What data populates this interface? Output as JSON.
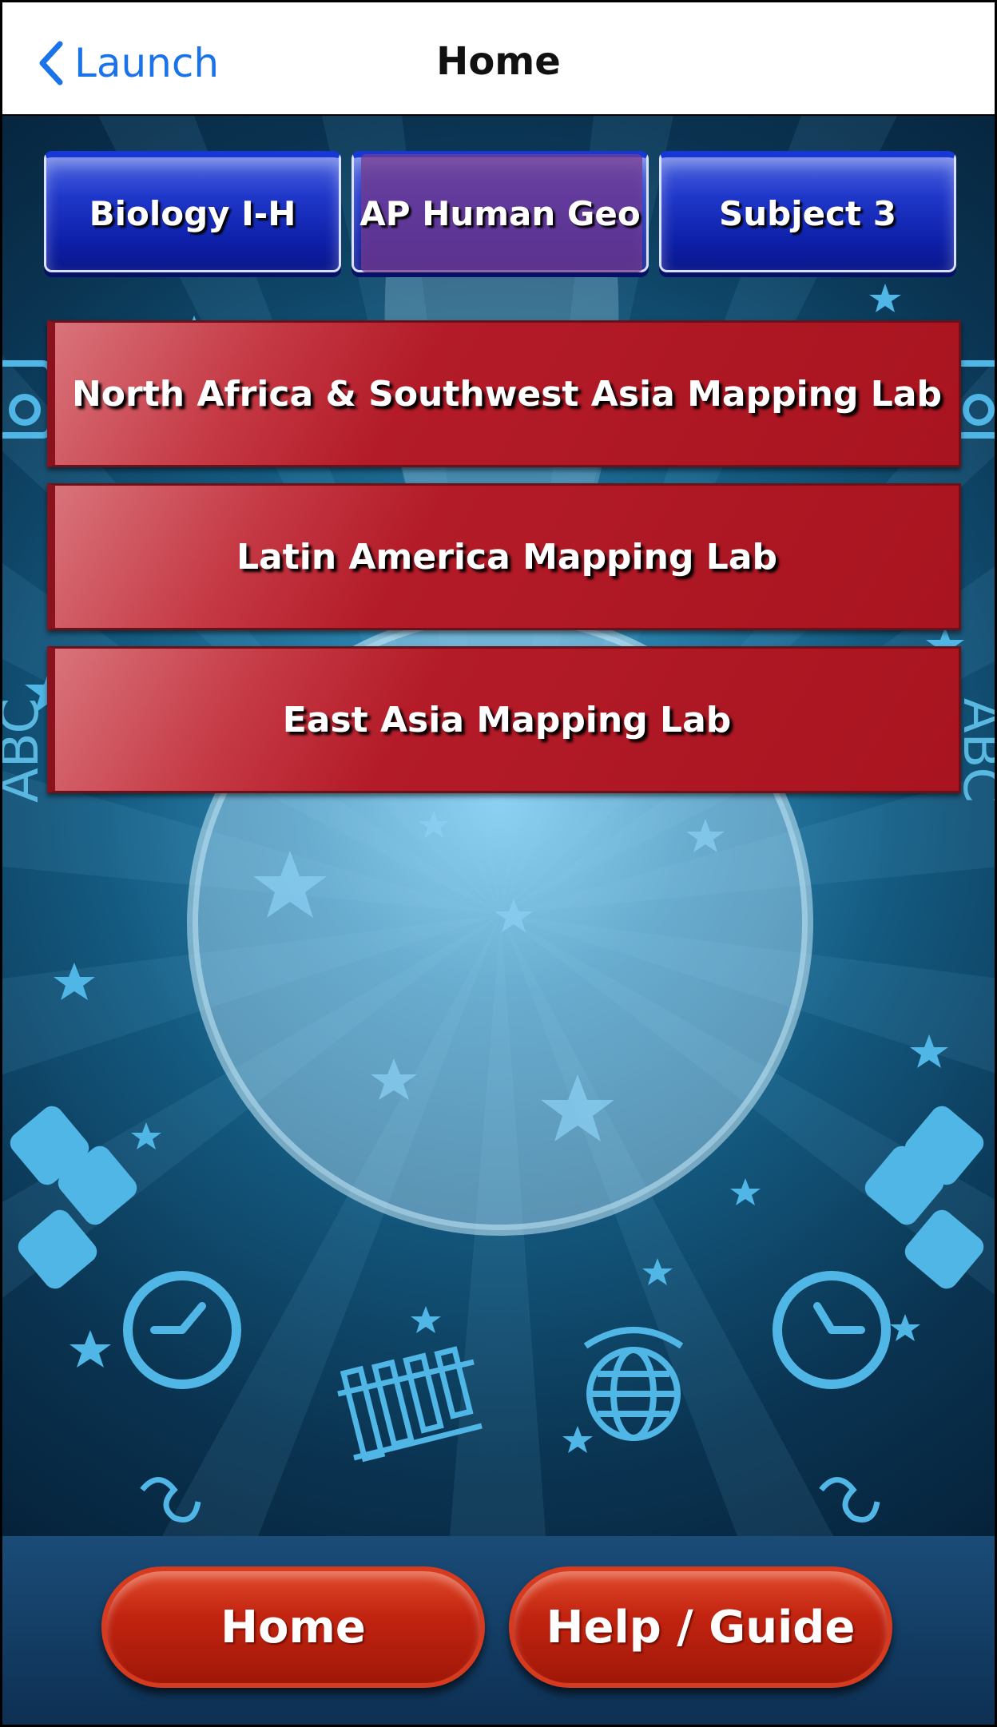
{
  "navbar": {
    "back_label": "Launch",
    "title": "Home"
  },
  "subjects": {
    "tab1": "Biology I-H",
    "tab2": "AP Human Geo",
    "tab3": "Subject 3",
    "selected_index": 1
  },
  "labs": [
    {
      "label": "North Africa & Southwest Asia Mapping Lab"
    },
    {
      "label": "Latin America Mapping Lab"
    },
    {
      "label": "East Asia Mapping Lab"
    }
  ],
  "decor": {
    "side_text_left": "ABC",
    "side_text_right": "ABC",
    "icons": [
      "star-icon",
      "clock-icon",
      "calculator-icon",
      "globe-icon",
      "xylophone-icon",
      "om-icon",
      "camera-icon"
    ]
  },
  "bottom": {
    "home_label": "Home",
    "help_label": "Help / Guide"
  },
  "colors": {
    "nav_accent": "#1a73e8",
    "tab_blue": "#1f37c9",
    "tab_selected": "#7a3c8c",
    "lab_red": "#b31b28",
    "pill_red": "#c22410",
    "background_blue": "#0a3452"
  }
}
